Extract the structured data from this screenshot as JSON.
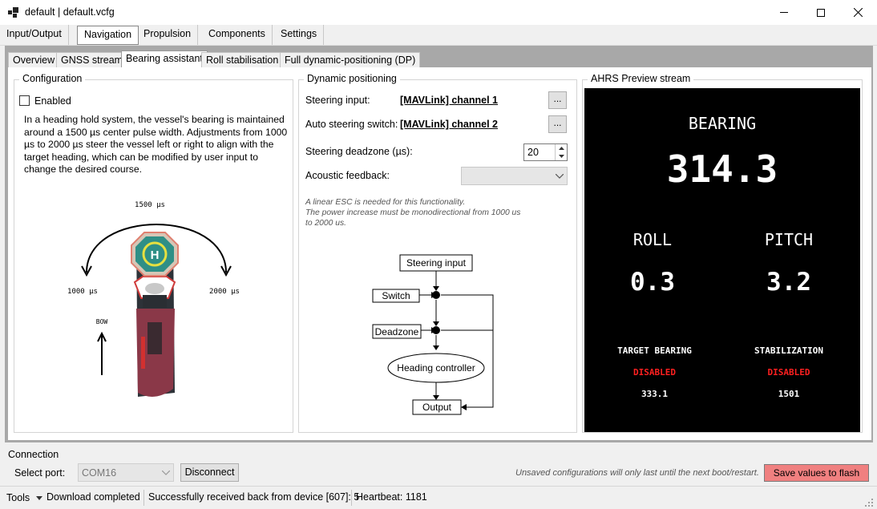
{
  "window": {
    "title": "default | default.vcfg"
  },
  "menu_tabs": [
    {
      "label": "Input/Output"
    },
    {
      "label": "Navigation"
    },
    {
      "label": "Propulsion"
    },
    {
      "label": "Components"
    },
    {
      "label": "Settings"
    }
  ],
  "sub_tabs": [
    {
      "label": "Overview"
    },
    {
      "label": "GNSS stream"
    },
    {
      "label": "Bearing assistant"
    },
    {
      "label": "Roll stabilisation"
    },
    {
      "label": "Full dynamic-positioning (DP)"
    }
  ],
  "configuration": {
    "title": "Configuration",
    "enabled_label": "Enabled",
    "enabled_checked": false,
    "description": "In a heading hold system, the vessel's bearing is maintained around a 1500 µs center pulse width. Adjustments from 1000 µs to 2000 µs steer the vessel left or right to align with the target heading, which can be modified by user input to change the desired course.",
    "diagram": {
      "top_label": "1500 µs",
      "left_label": "1000 µs",
      "right_label": "2000 µs",
      "bow_label": "BOW",
      "helipad_letter": "H"
    }
  },
  "dynamic_positioning": {
    "title": "Dynamic positioning",
    "steering_input_label": "Steering input:",
    "steering_input_value": "[MAVLink] channel 1",
    "auto_switch_label": "Auto steering switch:",
    "auto_switch_value": "[MAVLink] channel 2",
    "browse_label": "...",
    "deadzone_label": "Steering deadzone (µs):",
    "deadzone_value": "20",
    "acoustic_label": "Acoustic feedback:",
    "acoustic_value": "",
    "note_line1": "A linear ESC is needed for this functionality.",
    "note_line2": "The power increase must be monodirectional from 1000 us",
    "note_line3": "to 2000 us.",
    "flow": {
      "steering_input": "Steering input",
      "switch": "Switch",
      "deadzone": "Deadzone",
      "heading_controller": "Heading controller",
      "output": "Output"
    }
  },
  "ahrs": {
    "title": "AHRS Preview stream",
    "bearing_label": "BEARING",
    "bearing_value": "314.3",
    "roll_label": "ROLL",
    "roll_value": "0.3",
    "pitch_label": "PITCH",
    "pitch_value": "3.2",
    "target_bearing_label": "TARGET BEARING",
    "target_bearing_status": "DISABLED",
    "target_bearing_value": "333.1",
    "stabilization_label": "STABILIZATION",
    "stabilization_status": "DISABLED",
    "stabilization_value": "1501",
    "status_color": "#ff2020"
  },
  "connection": {
    "title": "Connection",
    "port_label": "Select port:",
    "port_value": "COM16",
    "disconnect_label": "Disconnect",
    "unsaved_note": "Unsaved configurations will only last until the next boot/restart.",
    "save_label": "Save values to flash",
    "save_color": "#f08080"
  },
  "status_bar": {
    "tools_label": "Tools",
    "download_status": "Download completed",
    "received_status": "Successfully received back from device [607]: 5",
    "heartbeat": "Heartbeat: 1181"
  }
}
